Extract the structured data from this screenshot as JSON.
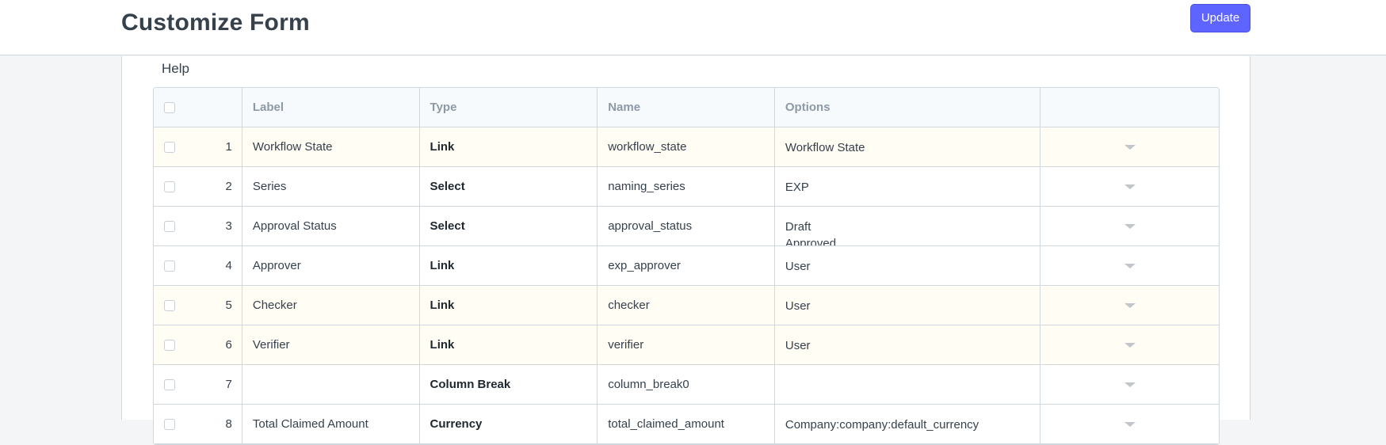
{
  "page": {
    "title": "Customize Form",
    "update_label": "Update",
    "help_label": "Help"
  },
  "grid": {
    "headers": {
      "label": "Label",
      "type": "Type",
      "name": "Name",
      "options": "Options"
    },
    "rows": [
      {
        "idx": "1",
        "label": "Workflow State",
        "type": "Link",
        "name": "workflow_state",
        "options": [
          "Workflow State"
        ]
      },
      {
        "idx": "2",
        "label": "Series",
        "type": "Select",
        "name": "naming_series",
        "options": [
          "EXP"
        ]
      },
      {
        "idx": "3",
        "label": "Approval Status",
        "type": "Select",
        "name": "approval_status",
        "options": [
          "Draft",
          "Approved"
        ]
      },
      {
        "idx": "4",
        "label": "Approver",
        "type": "Link",
        "name": "exp_approver",
        "options": [
          "User"
        ]
      },
      {
        "idx": "5",
        "label": "Checker",
        "type": "Link",
        "name": "checker",
        "options": [
          "User"
        ]
      },
      {
        "idx": "6",
        "label": "Verifier",
        "type": "Link",
        "name": "verifier",
        "options": [
          "User"
        ]
      },
      {
        "idx": "7",
        "label": "",
        "type": "Column Break",
        "name": "column_break0",
        "options": [
          ""
        ]
      },
      {
        "idx": "8",
        "label": "Total Claimed Amount",
        "type": "Currency",
        "name": "total_claimed_amount",
        "options": [
          "Company:company:default_currency"
        ]
      }
    ],
    "highlighted": [
      0,
      4,
      5
    ]
  },
  "icons": {
    "row_action": "chevron-down-icon",
    "row_select": "checkbox"
  }
}
